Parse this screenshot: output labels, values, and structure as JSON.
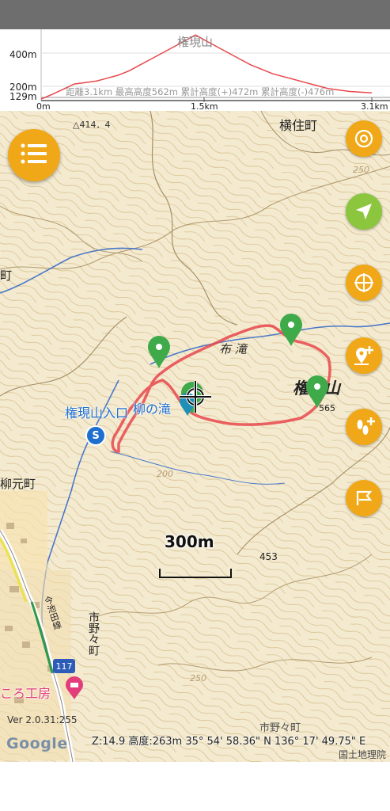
{
  "profile": {
    "peak_label": "権現山",
    "y_labels": [
      "400m",
      "200m",
      "129m"
    ],
    "x_labels": [
      "0m",
      "1.5km",
      "3.1km"
    ],
    "stats": "距離3.1km  最高高度562m  累計高度(+)472m  累計高度(-)476m",
    "elevation_series": [
      129,
      160,
      195,
      230,
      240,
      250,
      270,
      290,
      320,
      360,
      400,
      440,
      480,
      520,
      562,
      520,
      480,
      440,
      400,
      360,
      330,
      300,
      280,
      260,
      240,
      220,
      200,
      190,
      180,
      175,
      170
    ]
  },
  "map": {
    "labels": {
      "elevation_414": "△414．4",
      "yokozumi": "横住町",
      "nunotaki": "布 滝",
      "gongen_yama": "権現山",
      "elev_565": "565",
      "trailhead": "権現山入口",
      "yanagi_no_taki": "柳の滝",
      "yanagimoto": "柳元町",
      "contour_200": "200",
      "contour_250": "250",
      "contour_250b": "250",
      "elev_453": "453",
      "ichinono": "市野々町",
      "ichinono_b": "市野々町",
      "road_117": "117",
      "road_name": "今池田線",
      "lodge": "ころ工房",
      "scale": "300m",
      "left_edge": "町",
      "kokudo": "国土地理院",
      "version": "Ver 2.0.31:255",
      "google": "Google",
      "coords": "Z:14.9 高度:263m  35° 54' 58.36\" N 136° 17' 49.75\" E"
    },
    "colors": {
      "track": "#e8474b",
      "fab_orange": "#f0a818",
      "fab_green": "#8cc63f",
      "marker_green": "#3faa4a"
    }
  },
  "buttons": {
    "menu": "menu-icon",
    "record": "spiral-icon",
    "locate": "navigation-arrow-icon",
    "compass": "target-icon",
    "add_marker": "add-pin-icon",
    "add_footprint": "add-footprint-icon",
    "flag": "flag-icon"
  }
}
